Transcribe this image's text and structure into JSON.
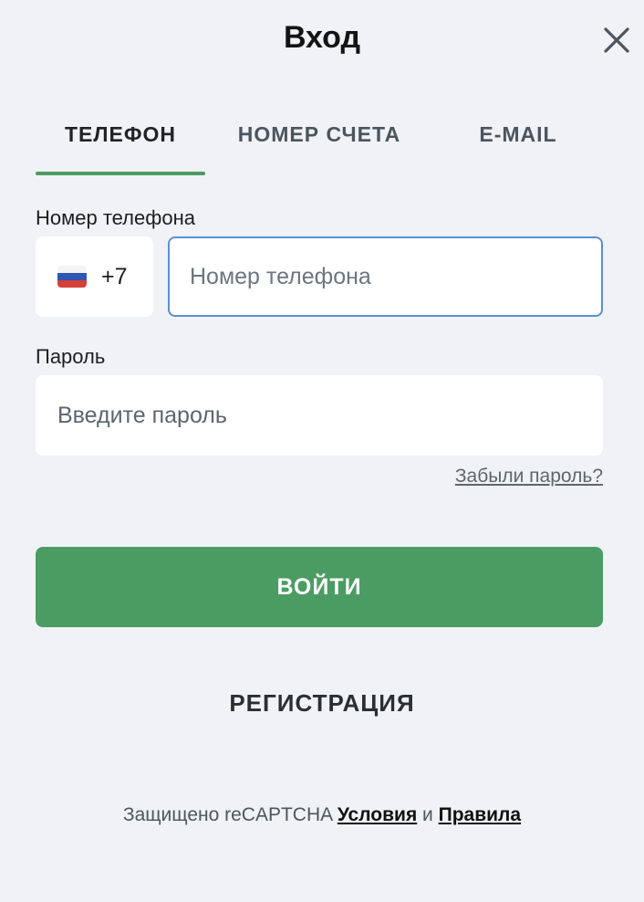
{
  "header": {
    "title": "Вход",
    "close_icon": "close-icon"
  },
  "tabs": [
    {
      "label": "ТЕЛЕФОН",
      "active": true
    },
    {
      "label": "НОМЕР СЧЕТА",
      "active": false
    },
    {
      "label": "E-MAIL",
      "active": false
    }
  ],
  "phone": {
    "label": "Номер телефона",
    "country_flag": "russia-flag-icon",
    "country_code": "+7",
    "placeholder": "Номер телефона",
    "value": ""
  },
  "password": {
    "label": "Пароль",
    "placeholder": "Введите пароль",
    "value": ""
  },
  "forgot_link": "Забыли пароль?",
  "login_button": "ВОЙТИ",
  "register_link": "РЕГИСТРАЦИЯ",
  "footer": {
    "prefix": "Защищено reCAPTCHA",
    "terms": "Условия",
    "and": "и",
    "rules": "Правила"
  },
  "colors": {
    "accent_green": "#4b9c63",
    "focus_blue": "#5b8fd6",
    "background": "#f0f2f5"
  }
}
